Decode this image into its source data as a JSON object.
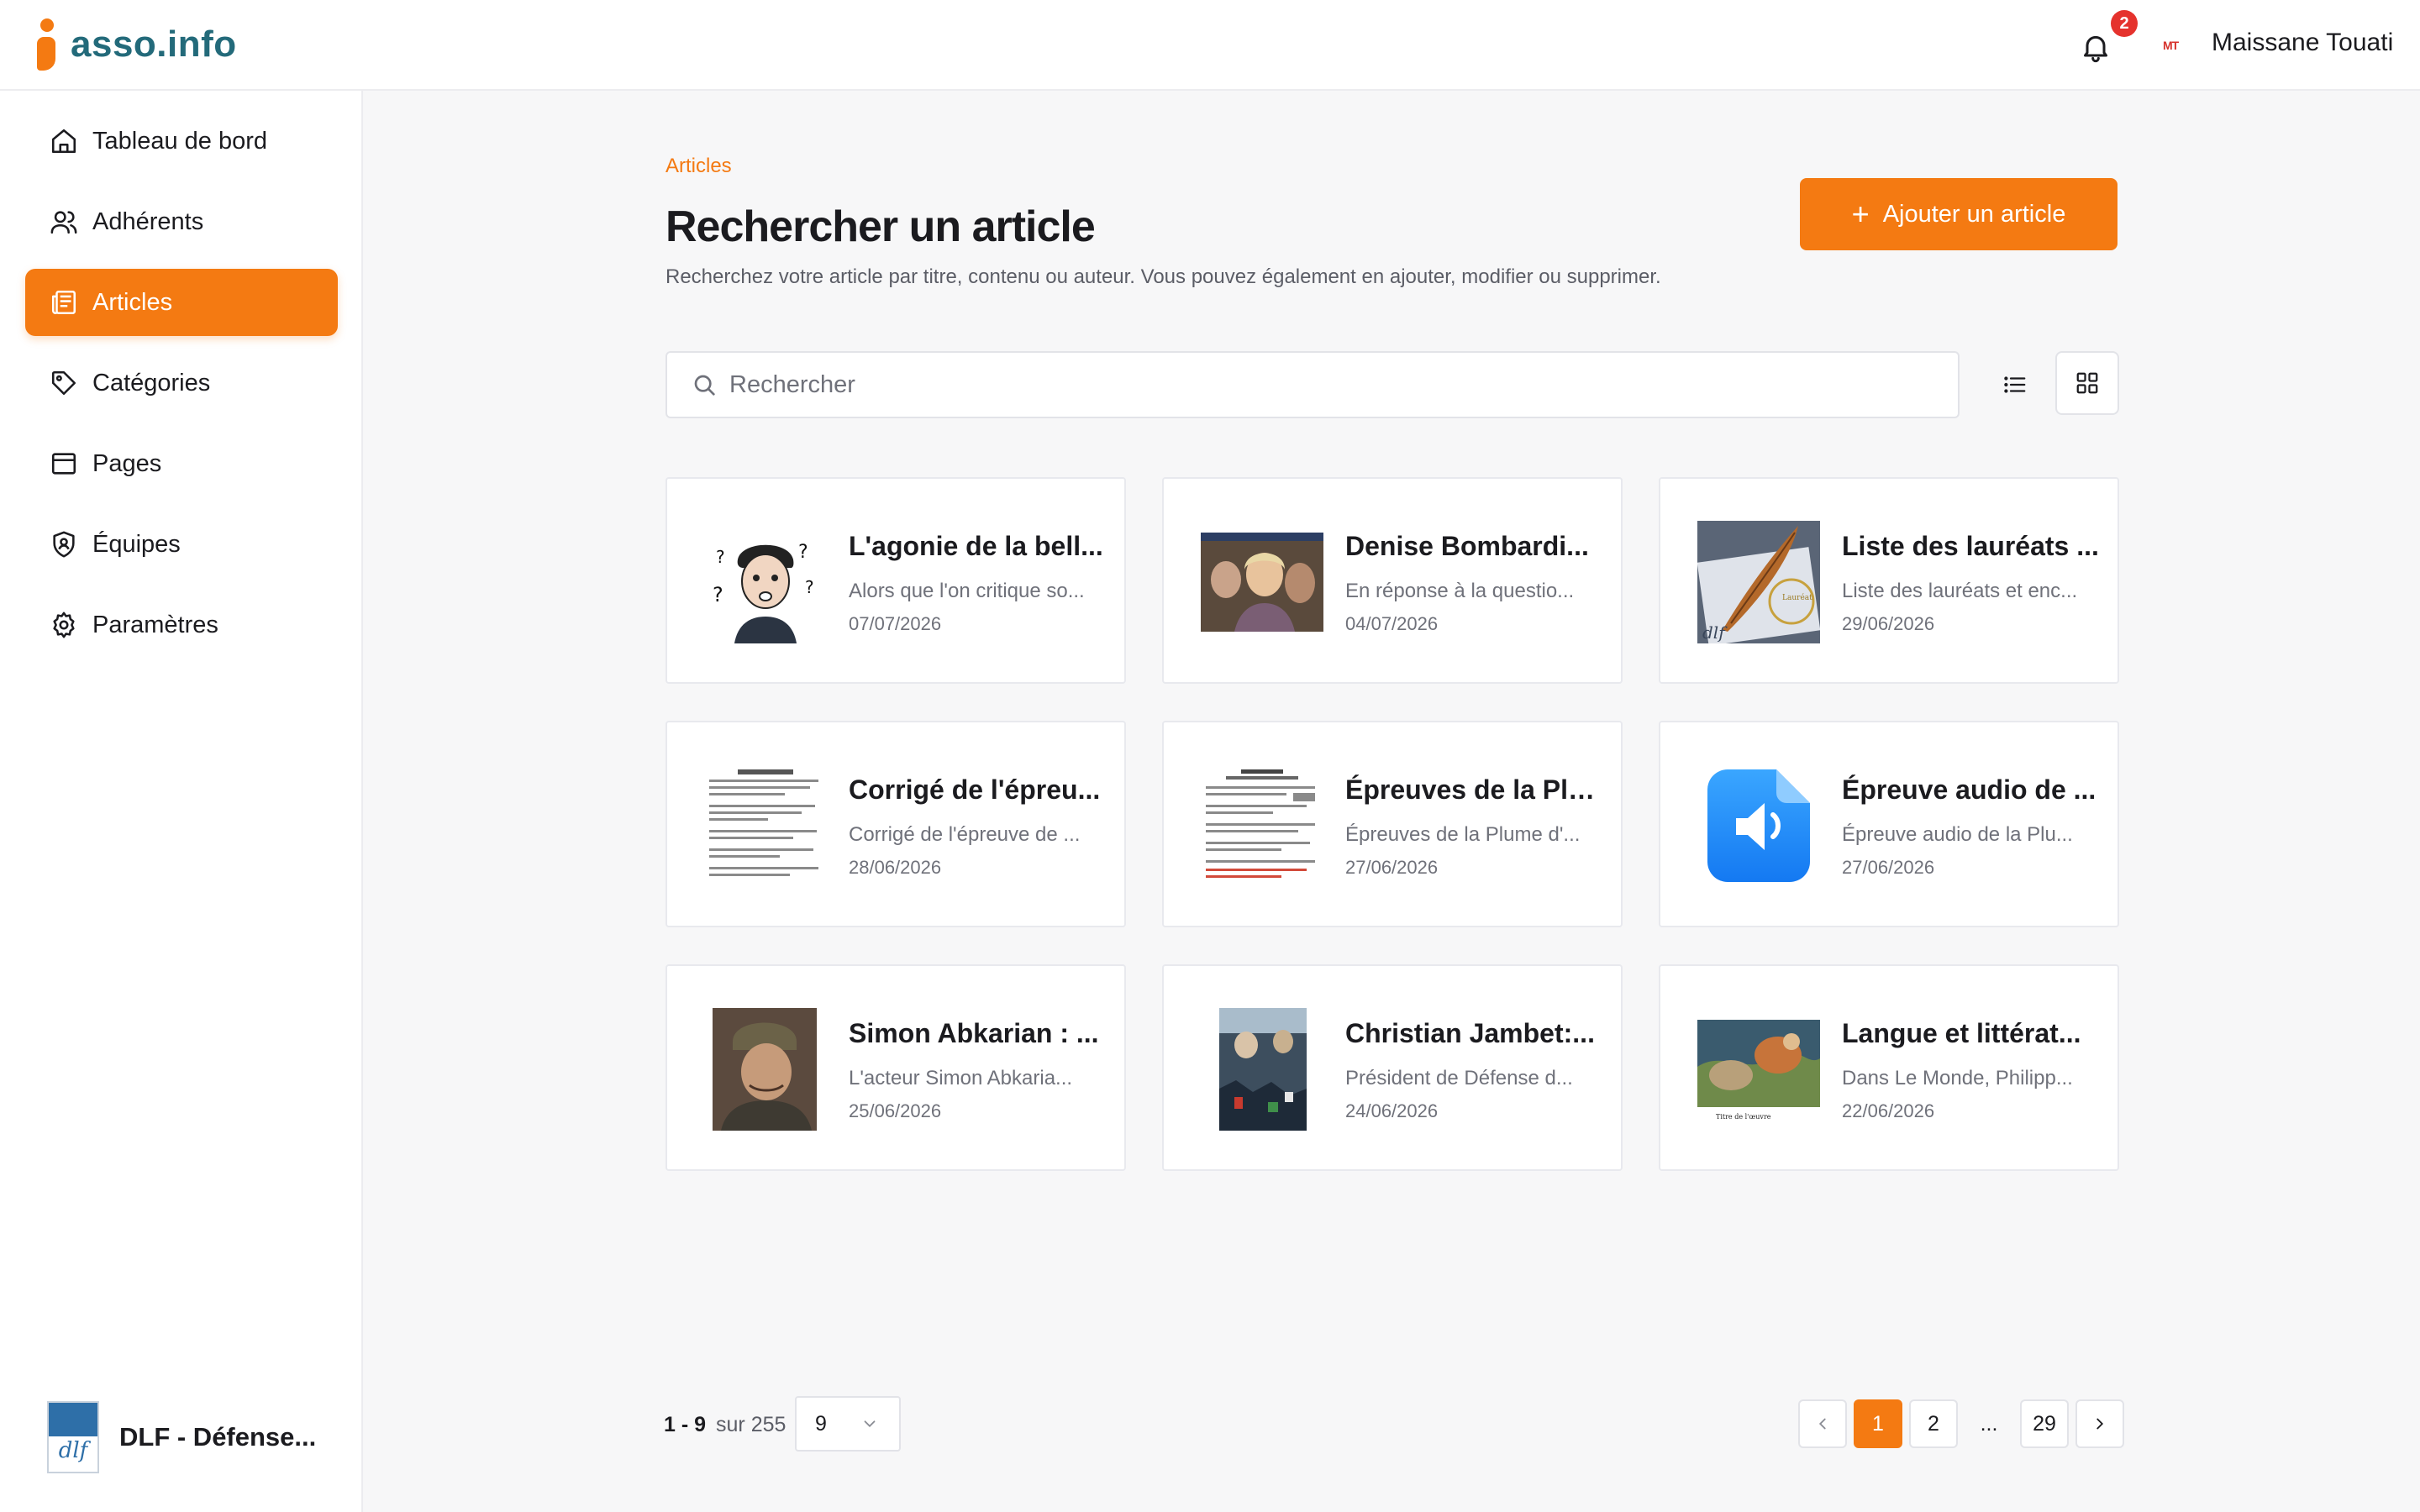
{
  "app": {
    "logo_text": "asso.info"
  },
  "header": {
    "notifications_count": "2",
    "user_initials": "MT",
    "user_name": "Maissane Touati"
  },
  "sidebar": {
    "items": [
      {
        "label": "Tableau de bord",
        "icon": "home-icon",
        "active": false
      },
      {
        "label": "Adhérents",
        "icon": "users-icon",
        "active": false
      },
      {
        "label": "Articles",
        "icon": "newspaper-icon",
        "active": true
      },
      {
        "label": "Catégories",
        "icon": "tag-icon",
        "active": false
      },
      {
        "label": "Pages",
        "icon": "page-icon",
        "active": false
      },
      {
        "label": "Équipes",
        "icon": "shield-icon",
        "active": false
      },
      {
        "label": "Paramètres",
        "icon": "gear-icon",
        "active": false
      }
    ],
    "org_name": "DLF - Défense...",
    "org_logo_text": "dlf"
  },
  "main": {
    "breadcrumb": "Articles",
    "title": "Rechercher un article",
    "description": "Recherchez votre article par titre, contenu ou auteur. Vous pouvez également en ajouter, modifier ou supprimer.",
    "add_button": "Ajouter un article",
    "search_placeholder": "Rechercher"
  },
  "articles": [
    {
      "title": "L'agonie de la bell...",
      "excerpt": "Alors que l'on critique so...",
      "date": "07/07/2026",
      "thumb": "cartoon-face"
    },
    {
      "title": "Denise Bombardi...",
      "excerpt": "En réponse à la questio...",
      "date": "04/07/2026",
      "thumb": "photo-woman"
    },
    {
      "title": "Liste des lauréats ...",
      "excerpt": "Liste des lauréats et enc...",
      "date": "29/06/2026",
      "thumb": "quill-laurel"
    },
    {
      "title": "Corrigé de l'épreu...",
      "excerpt": "Corrigé de l'épreuve de ...",
      "date": "28/06/2026",
      "thumb": "document"
    },
    {
      "title": "Épreuves de la Plu...",
      "excerpt": "Épreuves de la Plume d'...",
      "date": "27/06/2026",
      "thumb": "document-red"
    },
    {
      "title": "Épreuve audio de ...",
      "excerpt": "Épreuve audio de la Plu...",
      "date": "27/06/2026",
      "thumb": "audio-file"
    },
    {
      "title": "Simon Abkarian : ...",
      "excerpt": "L'acteur Simon Abkaria...",
      "date": "25/06/2026",
      "thumb": "photo-actor"
    },
    {
      "title": "Christian Jambet:...",
      "excerpt": "Président de Défense d...",
      "date": "24/06/2026",
      "thumb": "poster"
    },
    {
      "title": "Langue et littérat...",
      "excerpt": "Dans Le Monde, Philipp...",
      "date": "22/06/2026",
      "thumb": "painting"
    }
  ],
  "pagination": {
    "range": "1 - 9",
    "total_label": "sur 255",
    "per_page": "9",
    "pages": [
      "1",
      "2",
      "...",
      "29"
    ],
    "current": "1"
  },
  "colors": {
    "accent": "#f47a12",
    "brand_text": "#236a7a",
    "badge": "#e5322d"
  }
}
